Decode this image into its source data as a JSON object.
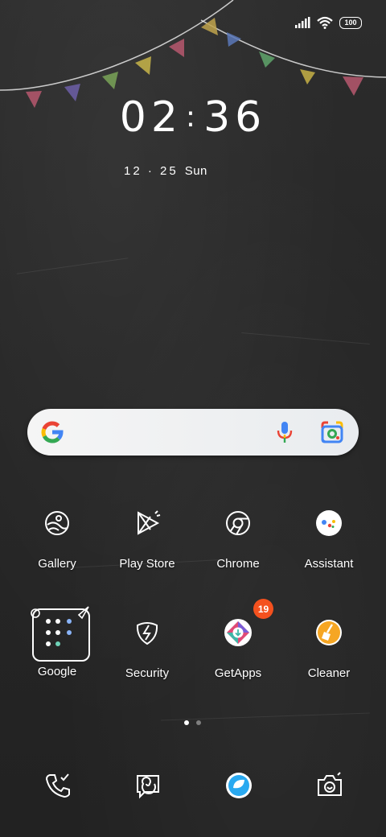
{
  "status_bar": {
    "battery_level": "100",
    "signal_icon": "signal-bars-icon",
    "wifi_icon": "wifi-icon"
  },
  "clock": {
    "hours": "02",
    "minutes": "36",
    "separator": ":"
  },
  "date": {
    "date_text": "12 · 25",
    "day": "Sun"
  },
  "search": {
    "logo": "google-g-icon",
    "voice_icon": "microphone-icon",
    "lens_icon": "google-lens-icon"
  },
  "apps_row1": [
    {
      "label": "Gallery",
      "icon": "gallery-icon"
    },
    {
      "label": "Play Store",
      "icon": "play-store-icon"
    },
    {
      "label": "Chrome",
      "icon": "chrome-icon"
    },
    {
      "label": "Assistant",
      "icon": "assistant-icon"
    }
  ],
  "apps_row2": [
    {
      "label": "Google",
      "icon": "folder-icon"
    },
    {
      "label": "Security",
      "icon": "security-icon"
    },
    {
      "label": "GetApps",
      "icon": "getapps-icon",
      "badge": "19"
    },
    {
      "label": "Cleaner",
      "icon": "cleaner-icon"
    }
  ],
  "page_indicator": {
    "pages": 2,
    "current": 1
  },
  "dock": [
    {
      "icon": "phone-icon"
    },
    {
      "icon": "messages-icon"
    },
    {
      "icon": "browser-icon"
    },
    {
      "icon": "camera-icon"
    }
  ],
  "colors": {
    "background": "#262626",
    "badge": "#f4511e",
    "cleaner": "#f6a623",
    "browser": "#29a9f0"
  }
}
